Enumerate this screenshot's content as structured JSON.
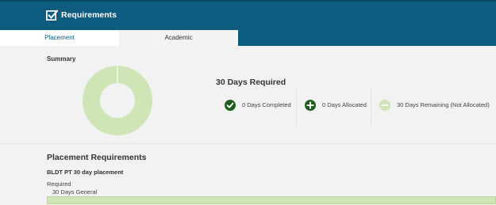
{
  "header": {
    "title": "Requirements",
    "icon": "checkbox-check-icon"
  },
  "tabs": [
    {
      "label": "Placement",
      "active": true
    },
    {
      "label": "Academic",
      "active": false
    }
  ],
  "summary": {
    "label": "Summary",
    "required_text": "30 Days Required",
    "donut": {
      "completed": 0,
      "allocated": 0,
      "remaining": 30,
      "color_remaining": "#cfe5b6"
    },
    "stats": [
      {
        "text": "0 Days Completed",
        "icon": "check-circle-icon",
        "color": "#1e5e1e"
      },
      {
        "text": "0 Days Allocated",
        "icon": "plus-circle-icon",
        "color": "#1e5e1e"
      },
      {
        "text": "30 Days Remaining (Not Allocated)",
        "icon": "minus-circle-icon",
        "color": "#cfe5b6"
      }
    ]
  },
  "requirements": {
    "title": "Placement Requirements",
    "item_title": "BLDT PT 30 day placement",
    "required_label": "Required",
    "days_text": "30 Days General"
  }
}
